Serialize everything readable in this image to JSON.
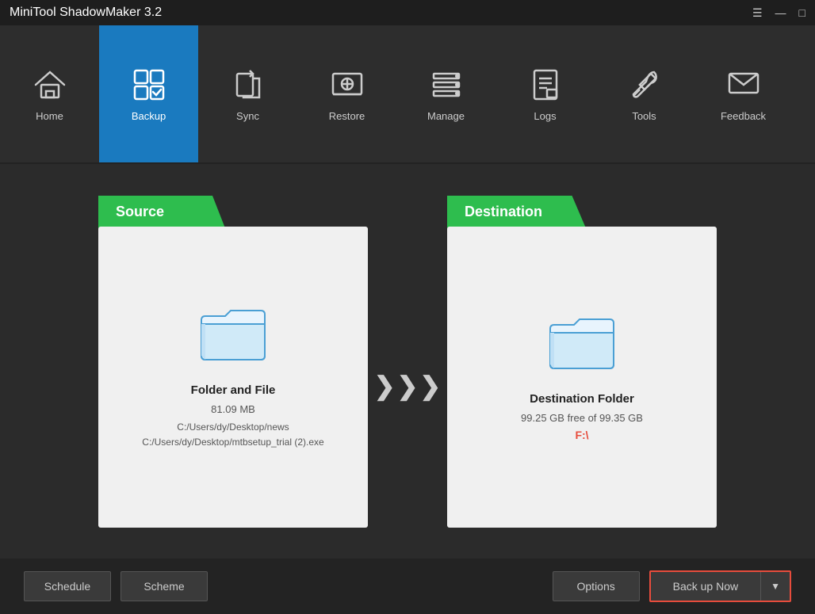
{
  "titlebar": {
    "title": "MiniTool ShadowMaker 3.2",
    "controls": {
      "menu": "☰",
      "minimize": "—",
      "maximize": "□"
    }
  },
  "navbar": {
    "items": [
      {
        "id": "home",
        "label": "Home",
        "active": false
      },
      {
        "id": "backup",
        "label": "Backup",
        "active": true
      },
      {
        "id": "sync",
        "label": "Sync",
        "active": false
      },
      {
        "id": "restore",
        "label": "Restore",
        "active": false
      },
      {
        "id": "manage",
        "label": "Manage",
        "active": false
      },
      {
        "id": "logs",
        "label": "Logs",
        "active": false
      },
      {
        "id": "tools",
        "label": "Tools",
        "active": false
      },
      {
        "id": "feedback",
        "label": "Feedback",
        "active": false
      }
    ]
  },
  "source": {
    "label": "Source",
    "title": "Folder and File",
    "size": "81.09 MB",
    "paths": [
      "C:/Users/dy/Desktop/news",
      "C:/Users/dy/Desktop/mtbsetup_trial (2).exe"
    ]
  },
  "destination": {
    "label": "Destination",
    "title": "Destination Folder",
    "free_space": "99.25 GB free of 99.35 GB",
    "drive": "F:\\"
  },
  "toolbar": {
    "schedule_label": "Schedule",
    "scheme_label": "Scheme",
    "options_label": "Options",
    "backup_now_label": "Back up Now",
    "dropdown_arrow": "▼"
  }
}
